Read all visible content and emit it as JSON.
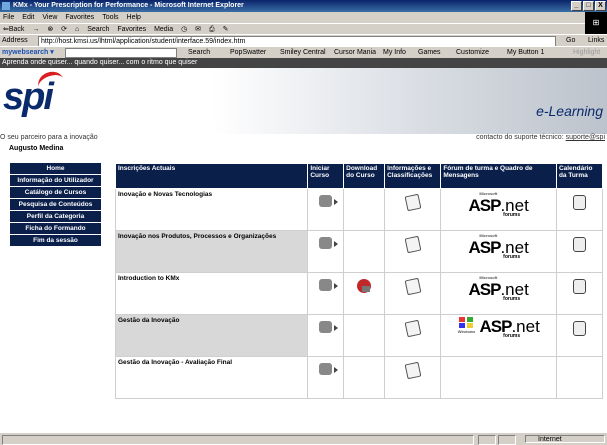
{
  "window": {
    "title": "KMx - Your Prescription for Performance - Microsoft Internet Explorer",
    "buttons": [
      "_",
      "□",
      "X"
    ]
  },
  "menubar": [
    "File",
    "Edit",
    "View",
    "Favorites",
    "Tools",
    "Help"
  ],
  "toolbar": {
    "back": "⇐Back",
    "search": "Search",
    "favorites": "Favorites",
    "media": "Media"
  },
  "addressbar": {
    "label": "Address",
    "url": "http://host.kmsi.us/lhtml/application/student/interface.59/index.htm",
    "go": "Go",
    "links": "Links"
  },
  "linksbar": {
    "brand": "mywebsearch ▾",
    "search_label": "Search",
    "items": [
      "PopSwatter",
      "Smiley Central",
      "Cursor Mania",
      "My Info",
      "Games",
      "Customize",
      "My Button 1",
      "Highlight"
    ]
  },
  "page": {
    "tagline": "Aprenda onde quiser... quando quiser... com o ritmo que quiser",
    "logo": "spi",
    "brand_right": "e-Learning",
    "partner_text": "O seu parceiro para a inovação",
    "support_prefix": "contacto do suporte técnico:",
    "support_link": "suporte@spi",
    "user_name": "Augusto Medina"
  },
  "sidebar": [
    "Home",
    "Informação do Utilizador",
    "Catálogo de Cursos",
    "Pesquisa de Conteúdos",
    "Perfil da Categoria",
    "Ficha do Formando",
    "Fim da sessão"
  ],
  "table": {
    "headers": [
      "Inscrições Actuais",
      "Iniciar Curso",
      "Download do Curso",
      "Informações e Classificações",
      "Fórum de turma e Quadro de Mensagens",
      "Calendário da Turma"
    ],
    "rows": [
      {
        "title": "Inovação e Novas Tecnologias",
        "shaded": false
      },
      {
        "title": "Inovação nos Produtos, Processos e Organizações",
        "shaded": true
      },
      {
        "title": "Introduction to KMx",
        "shaded": false
      },
      {
        "title": "Gestão da Inovação",
        "shaded": true
      },
      {
        "title": "Gestão da Inovação - Avaliação Final",
        "shaded": false
      }
    ],
    "asp_ms": "Microsoft",
    "asp_text": "ASP",
    "net_text": ".net",
    "forums_text": "forums",
    "windows_text": "Windows"
  },
  "statusbar": {
    "zone": "Internet"
  }
}
